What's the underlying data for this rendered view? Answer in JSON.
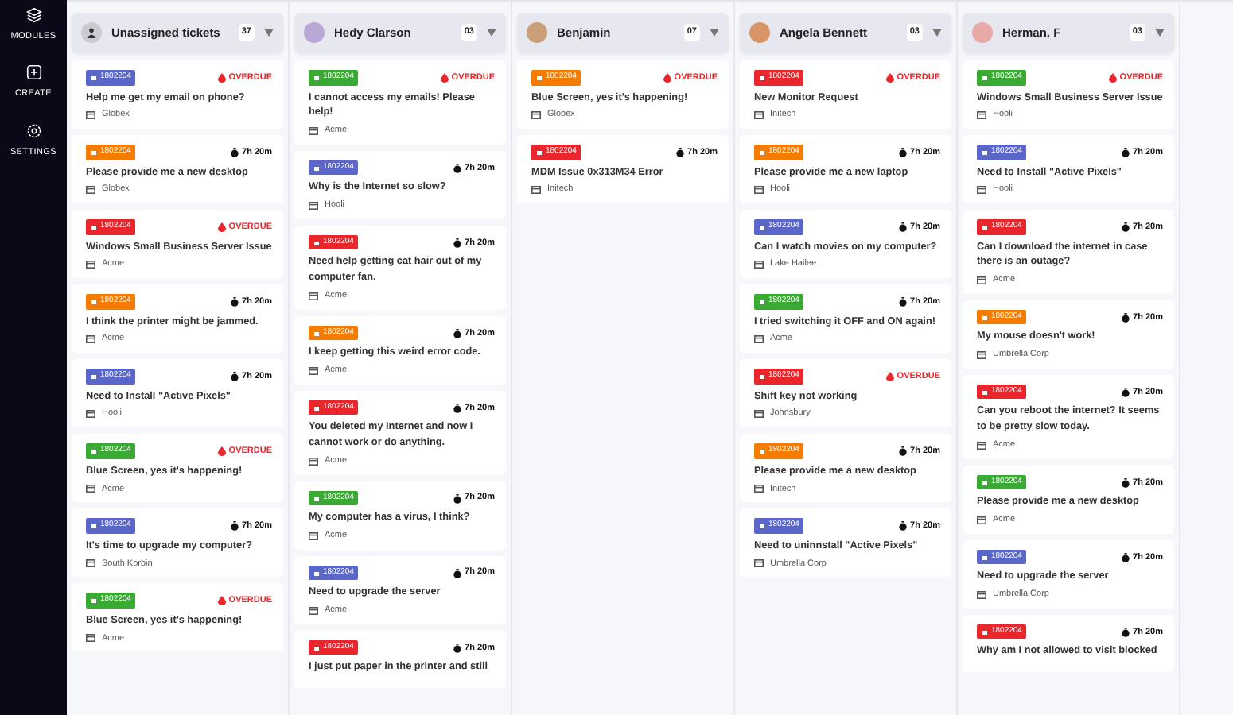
{
  "sidebar": {
    "items": [
      {
        "kind": "modules",
        "label": "MODULES"
      },
      {
        "kind": "create",
        "label": "CREATE"
      },
      {
        "kind": "settings",
        "label": "SETTINGS"
      }
    ]
  },
  "columns": [
    {
      "title": "Unassigned tickets",
      "kind": "unassigned",
      "count": "37",
      "tickets": [
        {
          "id": "1802204",
          "color": "#5b67c8",
          "title": "Help me get my email on phone?",
          "overdue": true,
          "status": "OVERDUE",
          "company": "Globex"
        },
        {
          "id": "1802204",
          "color": "#f57c00",
          "title": "Please provide me a new desktop",
          "overdue": false,
          "status": "7h 20m",
          "company": "Globex"
        },
        {
          "id": "1802204",
          "color": "#e8262b",
          "title": "Windows Small Business Server Issue",
          "overdue": true,
          "status": "OVERDUE",
          "company": "Acme"
        },
        {
          "id": "1802204",
          "color": "#f57c00",
          "title": "I think the printer might be jammed.",
          "overdue": false,
          "status": "7h 20m",
          "company": "Acme"
        },
        {
          "id": "1802204",
          "color": "#5b67c8",
          "title": "Need to Install \"Active Pixels\"",
          "overdue": false,
          "status": "7h 20m",
          "company": "Hooli"
        },
        {
          "id": "1802204",
          "color": "#3aaa35",
          "title": "Blue Screen, yes it's happening!",
          "overdue": true,
          "status": "OVERDUE",
          "company": "Acme"
        },
        {
          "id": "1802204",
          "color": "#5b67c8",
          "title": "It's time to upgrade my computer?",
          "overdue": false,
          "status": "7h 20m",
          "company": "South Korbin"
        },
        {
          "id": "1802204",
          "color": "#3aaa35",
          "title": "Blue Screen, yes it's happening!",
          "overdue": true,
          "status": "OVERDUE",
          "company": "Acme"
        }
      ]
    },
    {
      "title": "Hedy Clarson",
      "kind": "assignee",
      "count": "03",
      "tickets": [
        {
          "id": "1802204",
          "color": "#3aaa35",
          "title": "I cannot access my emails! Please help!",
          "overdue": true,
          "status": "OVERDUE",
          "company": "Acme"
        },
        {
          "id": "1802204",
          "color": "#5b67c8",
          "title": "Why is the Internet so slow?",
          "overdue": false,
          "status": "7h 20m",
          "company": "Hooli"
        },
        {
          "id": "1802204",
          "color": "#e8262b",
          "title": "Need help getting cat hair out of my computer fan.",
          "overdue": false,
          "status": "7h 20m",
          "company": "Acme"
        },
        {
          "id": "1802204",
          "color": "#f57c00",
          "title": "I keep getting this weird error code.",
          "overdue": false,
          "status": "7h 20m",
          "company": "Acme"
        },
        {
          "id": "1802204",
          "color": "#e8262b",
          "title": "You deleted my Internet and now I cannot work or do anything.",
          "overdue": false,
          "status": "7h 20m",
          "company": "Acme"
        },
        {
          "id": "1802204",
          "color": "#3aaa35",
          "title": "My computer has a virus, I think?",
          "overdue": false,
          "status": "7h 20m",
          "company": "Acme"
        },
        {
          "id": "1802204",
          "color": "#5b67c8",
          "title": "Need to upgrade the server",
          "overdue": false,
          "status": "7h 20m",
          "company": "Acme"
        },
        {
          "id": "1802204",
          "color": "#e8262b",
          "title": "I just put paper in the printer and still",
          "overdue": false,
          "status": "7h 20m"
        }
      ]
    },
    {
      "title": "Benjamin",
      "kind": "assignee",
      "count": "07",
      "tickets": [
        {
          "id": "1802204",
          "color": "#f57c00",
          "title": "Blue Screen, yes it's happening!",
          "overdue": true,
          "status": "OVERDUE",
          "company": "Globex"
        },
        {
          "id": "1802204",
          "color": "#e8262b",
          "title": "MDM Issue 0x313M34 Error",
          "overdue": false,
          "status": "7h 20m",
          "company": "Initech"
        }
      ]
    },
    {
      "title": "Angela Bennett",
      "kind": "assignee",
      "count": "03",
      "tickets": [
        {
          "id": "1802204",
          "color": "#e8262b",
          "title": "New Monitor Request",
          "overdue": true,
          "status": "OVERDUE",
          "company": "Initech"
        },
        {
          "id": "1802204",
          "color": "#f57c00",
          "title": "Please provide me a new laptop",
          "overdue": false,
          "status": "7h 20m",
          "company": "Hooli"
        },
        {
          "id": "1802204",
          "color": "#5b67c8",
          "title": "Can I watch movies on my computer?",
          "overdue": false,
          "status": "7h 20m",
          "company": "Lake Hailee"
        },
        {
          "id": "1802204",
          "color": "#3aaa35",
          "title": "I tried switching it OFF and ON again!",
          "overdue": false,
          "status": "7h 20m",
          "company": "Acme"
        },
        {
          "id": "1802204",
          "color": "#e8262b",
          "title": "Shift key not working",
          "overdue": true,
          "status": "OVERDUE",
          "company": "Johnsbury"
        },
        {
          "id": "1802204",
          "color": "#f57c00",
          "title": "Please provide me a new desktop",
          "overdue": false,
          "status": "7h 20m",
          "company": "Initech"
        },
        {
          "id": "1802204",
          "color": "#5b67c8",
          "title": "Need to uninnstall \"Active Pixels\"",
          "overdue": false,
          "status": "7h 20m",
          "company": "Umbrella Corp"
        }
      ]
    },
    {
      "title": "Herman. F",
      "kind": "assignee",
      "count": "03",
      "tickets": [
        {
          "id": "1802204",
          "color": "#3aaa35",
          "title": "Windows Small Business Server Issue",
          "overdue": true,
          "status": "OVERDUE",
          "company": "Hooli"
        },
        {
          "id": "1802204",
          "color": "#5b67c8",
          "title": "Need to Install \"Active Pixels\"",
          "overdue": false,
          "status": "7h 20m",
          "company": "Hooli"
        },
        {
          "id": "1802204",
          "color": "#e8262b",
          "title": "Can I download the internet in case there is an outage?",
          "overdue": false,
          "status": "7h 20m",
          "company": "Acme"
        },
        {
          "id": "1802204",
          "color": "#f57c00",
          "title": "My mouse doesn't work!",
          "overdue": false,
          "status": "7h 20m",
          "company": "Umbrella Corp"
        },
        {
          "id": "1802204",
          "color": "#e8262b",
          "title": "Can you reboot the internet? It seems to be pretty slow today.",
          "overdue": false,
          "status": "7h 20m",
          "company": "Acme"
        },
        {
          "id": "1802204",
          "color": "#3aaa35",
          "title": "Please provide me a new desktop",
          "overdue": false,
          "status": "7h 20m",
          "company": "Acme"
        },
        {
          "id": "1802204",
          "color": "#5b67c8",
          "title": "Need to upgrade the server",
          "overdue": false,
          "status": "7h 20m",
          "company": "Umbrella Corp"
        },
        {
          "id": "1802204",
          "color": "#e8262b",
          "title": "Why am I not allowed to visit blocked",
          "overdue": false,
          "status": "7h 20m"
        }
      ]
    }
  ]
}
